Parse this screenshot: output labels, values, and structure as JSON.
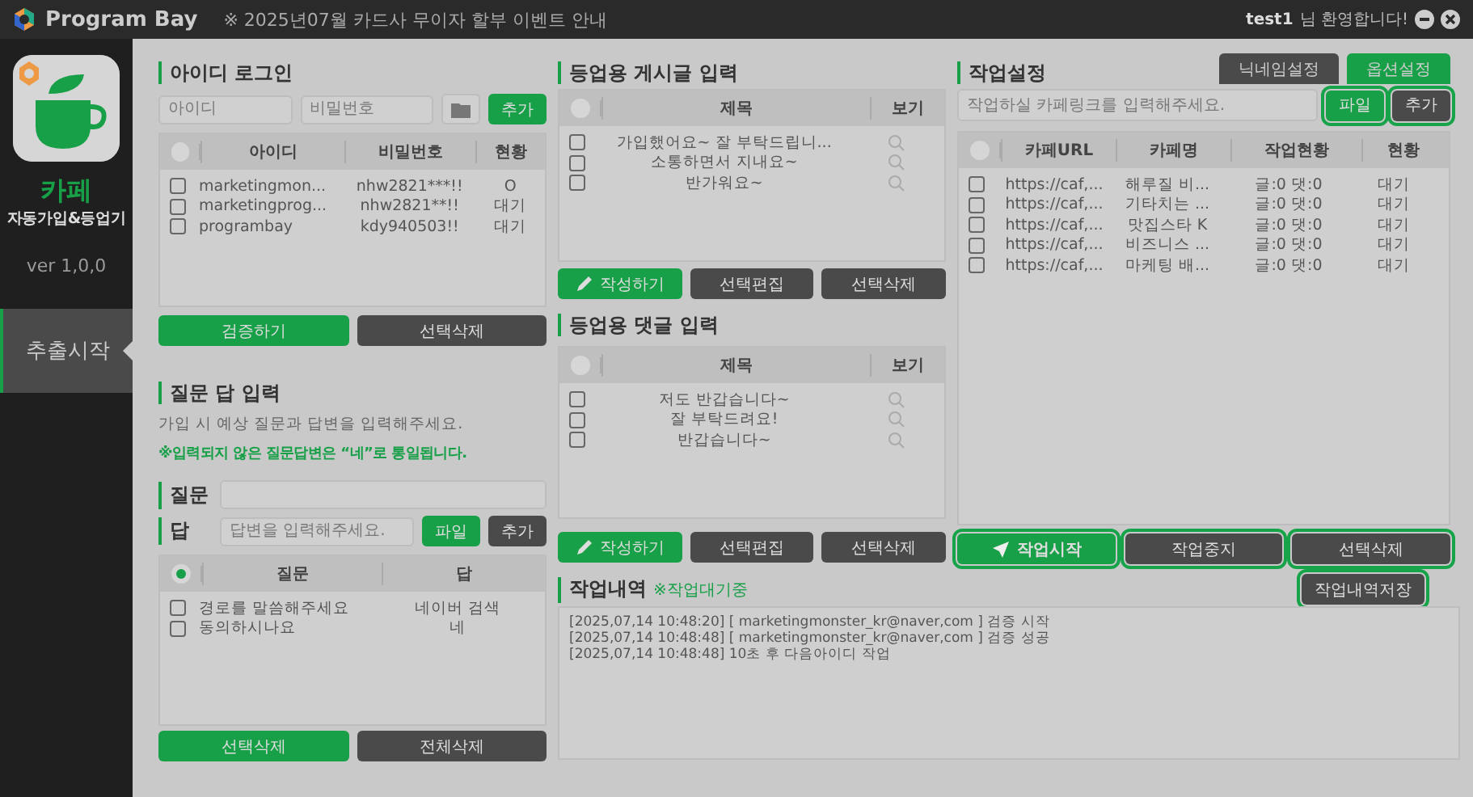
{
  "title_bar": {
    "brand": "Program Bay",
    "notice": "※ 2025년07월 카드사 무이자 할부 이벤트 안내",
    "user": "test1",
    "greeting": "님 환영합니다!"
  },
  "sidebar": {
    "app_name": "카페",
    "app_subtitle": "자동가입&등업기",
    "version": "ver 1,0,0",
    "items": [
      {
        "label": "추출시작",
        "selected": true
      }
    ]
  },
  "id_login": {
    "title": "아이디 로그인",
    "id_placeholder": "아이디",
    "password_placeholder": "비밀번호",
    "add_button": "추가",
    "table": {
      "all_checked": false,
      "columns": [
        "아이디",
        "비밀번호",
        "현황"
      ],
      "rows": [
        {
          "checked": false,
          "cells": [
            "marketingmon...",
            "nhw2821***!!",
            "O"
          ]
        },
        {
          "checked": false,
          "cells": [
            "marketingprog...",
            "nhw2821**!!",
            "대기"
          ]
        },
        {
          "checked": false,
          "cells": [
            "programbay",
            "kdy940503!!",
            "대기"
          ]
        }
      ]
    },
    "buttons": [
      {
        "label": "검증하기",
        "kind": "primary",
        "highlighted": false
      },
      {
        "label": "선택삭제",
        "kind": "secondary",
        "highlighted": false
      }
    ]
  },
  "qna": {
    "title": "질문 답 입력",
    "description": "가입 시 예상 질문과 답변을 입력해주세요.",
    "note": "※입력되지 않은 질문답변은 “네”로 통일됩니다.",
    "question_label": "질문",
    "answer_label": "답",
    "answer_placeholder": "답변을 입력해주세요.",
    "input_buttons": [
      {
        "label": "파일",
        "kind": "primary",
        "highlighted": false
      },
      {
        "label": "추가",
        "kind": "secondary",
        "highlighted": false
      }
    ],
    "table": {
      "all_checked": true,
      "columns": [
        "질문",
        "답"
      ],
      "rows": [
        {
          "checked": false,
          "cells": [
            "경로를 말씀해주세요",
            "네이버 검색"
          ]
        },
        {
          "checked": false,
          "cells": [
            "동의하시나요",
            "네"
          ]
        }
      ]
    },
    "buttons": [
      {
        "label": "선택삭제",
        "kind": "primary",
        "highlighted": false
      },
      {
        "label": "전체삭제",
        "kind": "secondary",
        "highlighted": false
      }
    ]
  },
  "posts": {
    "title": "등업용 게시글 입력",
    "table": {
      "all_checked": false,
      "columns": [
        "제목",
        "보기"
      ],
      "rows": [
        {
          "checked": false,
          "title": "가입했어요~ 잘 부탁드립니..."
        },
        {
          "checked": false,
          "title": "소통하면서 지내요~"
        },
        {
          "checked": false,
          "title": "반가워요~"
        }
      ]
    },
    "buttons": [
      {
        "label": "작성하기",
        "kind": "write",
        "highlighted": false
      },
      {
        "label": "선택편집",
        "kind": "secondary",
        "highlighted": false
      },
      {
        "label": "선택삭제",
        "kind": "secondary",
        "highlighted": false
      }
    ]
  },
  "comments": {
    "title": "등업용 댓글 입력",
    "table": {
      "all_checked": false,
      "columns": [
        "제목",
        "보기"
      ],
      "rows": [
        {
          "checked": false,
          "title": "저도 반갑습니다~"
        },
        {
          "checked": false,
          "title": "잘 부탁드려요!"
        },
        {
          "checked": false,
          "title": "반갑습니다~"
        }
      ]
    },
    "buttons": [
      {
        "label": "작성하기",
        "kind": "write",
        "highlighted": false
      },
      {
        "label": "선택편집",
        "kind": "secondary",
        "highlighted": false
      },
      {
        "label": "선택삭제",
        "kind": "secondary",
        "highlighted": false
      }
    ]
  },
  "job_settings": {
    "title": "작업설정",
    "tabs": [
      {
        "label": "닉네임설정",
        "selected": false
      },
      {
        "label": "옵션설정",
        "selected": true
      }
    ],
    "url_placeholder": "작업하실 카페링크를 입력해주세요.",
    "input_buttons": [
      {
        "label": "파일",
        "kind": "primary",
        "highlighted": true
      },
      {
        "label": "추가",
        "kind": "secondary",
        "highlighted": true
      }
    ],
    "table": {
      "all_checked": false,
      "columns": [
        "카페URL",
        "카페명",
        "작업현황",
        "현황"
      ],
      "rows": [
        {
          "checked": false,
          "cells": [
            "https://caf,...",
            "해루질 비...",
            "글:0 댓:0",
            "대기"
          ]
        },
        {
          "checked": false,
          "cells": [
            "https://caf,...",
            "기타치는 ...",
            "글:0 댓:0",
            "대기"
          ]
        },
        {
          "checked": false,
          "cells": [
            "https://caf,...",
            "맛집스타 K",
            "글:0 댓:0",
            "대기"
          ]
        },
        {
          "checked": false,
          "cells": [
            "https://caf,...",
            "비즈니스 ...",
            "글:0 댓:0",
            "대기"
          ]
        },
        {
          "checked": false,
          "cells": [
            "https://caf,...",
            "마케팅 배...",
            "글:0 댓:0",
            "대기"
          ]
        }
      ]
    },
    "buttons": [
      {
        "label": "작업시작",
        "kind": "start",
        "highlighted": true
      },
      {
        "label": "작업중지",
        "kind": "secondary",
        "highlighted": true
      },
      {
        "label": "선택삭제",
        "kind": "secondary",
        "highlighted": true
      }
    ]
  },
  "log": {
    "title": "작업내역",
    "status": "※작업대기중",
    "save_button": {
      "label": "작업내역저장",
      "kind": "secondary",
      "highlighted": true
    },
    "lines": [
      "[2025,07,14 10:48:20] [ marketingmonster_kr@naver,com ] 검증 시작",
      "[2025,07,14 10:48:48] [ marketingmonster_kr@naver,com ] 검증 성공",
      "[2025,07,14 10:48:48] 10초 후 다음아이디 작업"
    ]
  }
}
